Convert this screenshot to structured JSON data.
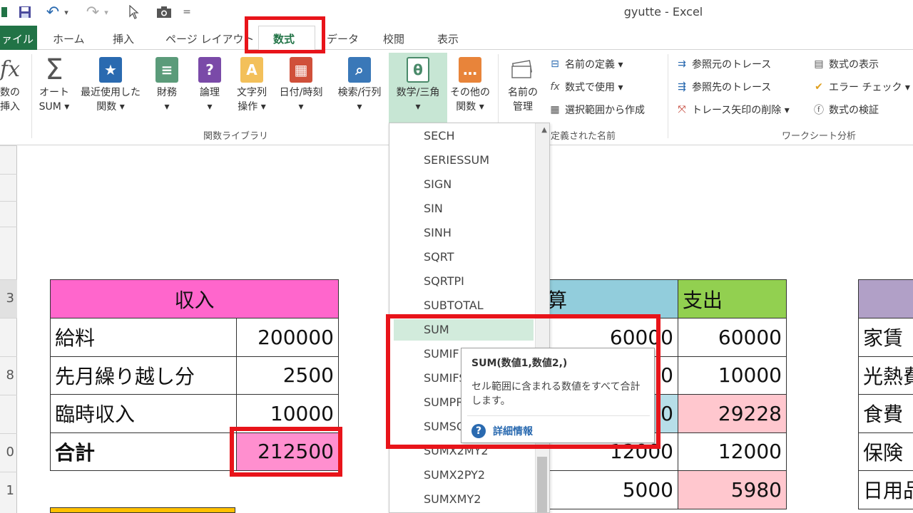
{
  "qat": {
    "save": "save-icon",
    "undo": "↶",
    "redo": "↷",
    "touch": "cursor-icon",
    "camera": "camera-icon",
    "more": "="
  },
  "window_title": "gyutte - Excel",
  "tabs": {
    "file": "ァイル",
    "home": "ホーム",
    "insert": "挿入",
    "layout": "ページ レイアウト",
    "formulas": "数式",
    "data": "データ",
    "review": "校閲",
    "view": "表示"
  },
  "ribbon": {
    "insert_function": [
      "数の",
      "挿入"
    ],
    "autosum": [
      "オート",
      "SUM ▾"
    ],
    "recent": [
      "最近使用した",
      "関数 ▾"
    ],
    "financial": [
      "財務",
      "▾"
    ],
    "logical": [
      "論理",
      "▾"
    ],
    "text": [
      "文字列",
      "操作 ▾"
    ],
    "datetime": [
      "日付/時刻",
      "▾"
    ],
    "lookup": [
      "検索/行列",
      "▾"
    ],
    "math": [
      "数学/三角",
      "▾"
    ],
    "more": [
      "その他の",
      "関数 ▾"
    ],
    "name_manager": [
      "名前の",
      "管理"
    ],
    "define_name": "名前の定義 ▾",
    "use_in_formula": "数式で使用 ▾",
    "create_from_selection": "選択範囲から作成",
    "trace_precedents": "参照元のトレース",
    "trace_dependents": "参照先のトレース",
    "remove_arrows": "トレース矢印の削除 ▾",
    "show_formulas": "数式の表示",
    "error_checking": "エラー チェック ▾",
    "evaluate_formula": "数式の検証",
    "group_function_library": "関数ライブラリ",
    "group_defined_names": "定義された名前",
    "group_formula_auditing": "ワークシート分析"
  },
  "row_headers": [
    "",
    "",
    "",
    "",
    "3",
    "",
    "8",
    "",
    "0",
    "1"
  ],
  "income": {
    "header": "収入",
    "rows": [
      {
        "label": "給料",
        "value": "200000"
      },
      {
        "label": "先月繰り越し分",
        "value": "2500"
      },
      {
        "label": "臨時収入",
        "value": "10000"
      }
    ],
    "total_label": "合計",
    "total_value": "212500"
  },
  "budget": {
    "header_budget": "算",
    "header_spent": "支出",
    "rows": [
      {
        "budget": "60000",
        "spent": "60000"
      },
      {
        "budget": "0",
        "spent": "10000"
      },
      {
        "budget": "0",
        "spent": "29228"
      },
      {
        "budget": "12000",
        "spent": "12000"
      },
      {
        "budget": "5000",
        "spent": "5980"
      }
    ]
  },
  "categories": {
    "rows": [
      "家賃",
      "光熱費",
      "食費",
      "保険",
      "日用品"
    ]
  },
  "dropdown": {
    "items": [
      "SECH",
      "SERIESSUM",
      "SIGN",
      "SIN",
      "SINH",
      "SQRT",
      "SQRTPI",
      "SUBTOTAL",
      "SUM",
      "SUMIF",
      "SUMIFS",
      "SUMPRODUCT",
      "SUMSQ",
      "SUMX2MY2",
      "SUMX2PY2",
      "SUMXMY2"
    ],
    "hovered": "SUM"
  },
  "tooltip": {
    "title": "SUM(数値1,数値2,)",
    "description": "セル範囲に含まれる数値をすべて合計します。",
    "link": "詳細情報",
    "help_icon": "?"
  },
  "colors": {
    "accent": "#217346",
    "highlight": "#e8141a",
    "income_header": "#ff66cc",
    "budget_header": "#92cddc",
    "spent_header": "#92d050",
    "red_text": "#c0121d"
  }
}
